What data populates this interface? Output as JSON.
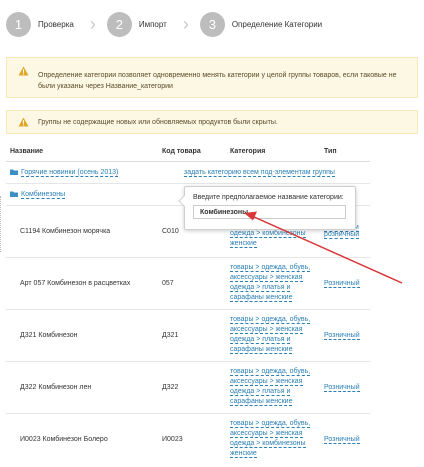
{
  "stepper": {
    "steps": [
      {
        "number": "1",
        "label": "Проверка"
      },
      {
        "number": "2",
        "label": "Импорт"
      },
      {
        "number": "3",
        "label": "Определение Категории"
      }
    ]
  },
  "alerts": {
    "info": "Определение категории позволяет одновременно менять категории у целой группы товаров, если таковые не были указаны через Название_категории",
    "hidden_groups": "Группы не содержащие новых или обновляемых продуктов были скрыты."
  },
  "table": {
    "headers": {
      "name": "Название",
      "code": "Код товара",
      "category": "Категория",
      "type": "Тип"
    },
    "groups": [
      {
        "name": "Горячие новинки (осень 2013)",
        "action": "задать категорию всем под-элементам группы"
      },
      {
        "name": "Комбинезоны"
      }
    ],
    "rows": [
      {
        "name": "C1194 Комбинезон морячка",
        "code": "C010",
        "category": [
          "одежда > комбинезоны",
          "женские"
        ],
        "type": "Оптовый и розничный"
      },
      {
        "name": "Арт 057 Комбинезон в расцветках",
        "code": "057",
        "category": [
          "товары > одежда, обувь,",
          "аксессуары > женская",
          "одежда > платья и",
          "сарафаны женские"
        ],
        "type": "Розничный"
      },
      {
        "name": "Д321 Комбинезон",
        "code": "Д321",
        "category": [
          "товары > одежда, обувь,",
          "аксессуары > женская",
          "одежда > платья и",
          "сарафаны женские"
        ],
        "type": "Розничный"
      },
      {
        "name": "Д322 Комбинезон лен",
        "code": "Д322",
        "category": [
          "товары > одежда, обувь,",
          "аксессуары > женская",
          "одежда > платья и",
          "сарафаны женские"
        ],
        "type": "Розничный"
      },
      {
        "name": "И0023 Комбинезон Болеро",
        "code": "И0023",
        "category": [
          "товары > одежда, обувь,",
          "аксессуары > женская",
          "одежда > комбинезоны",
          "женские"
        ],
        "type": "Розничный"
      }
    ]
  },
  "popover": {
    "title": "Введите предполагаемое название категории:",
    "input_value": "Комбинезоны"
  },
  "colors": {
    "link": "#2a7fb5",
    "alert_bg": "#fcf8e3",
    "step_circle": "#bdbdbd",
    "annotation_arrow": "#d9383a"
  },
  "icons": [
    "warning-icon",
    "folder-icon",
    "chevron-right-icon"
  ]
}
